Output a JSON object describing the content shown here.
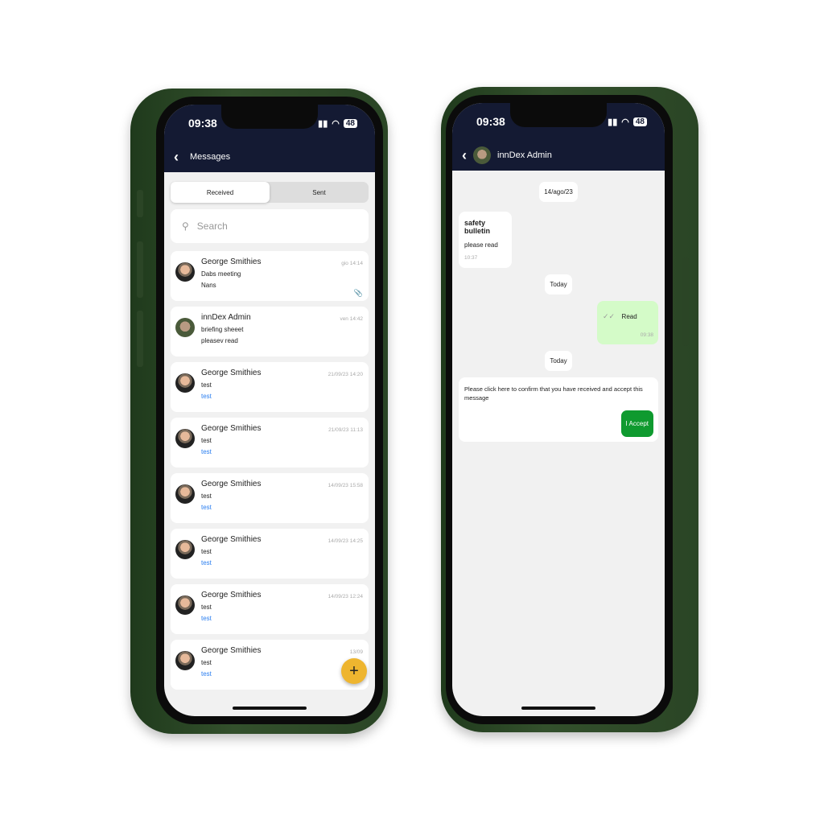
{
  "left_phone": {
    "status": {
      "time": "09:38",
      "battery": "48"
    },
    "header": {
      "title": "Messages"
    },
    "tabs": [
      {
        "label": "Received",
        "active": true
      },
      {
        "label": "Sent",
        "active": false
      }
    ],
    "search": {
      "placeholder": "Search"
    },
    "messages": [
      {
        "sender": "George Smithies",
        "subject": "Dabs meeting",
        "preview": "Nans",
        "time": "gio 14:14",
        "attachment": true
      },
      {
        "sender": "innDex Admin",
        "subject": "briefing sheeet",
        "preview": "pleasev read",
        "time": "ven 14:42"
      },
      {
        "sender": "George Smithies",
        "subject": "test",
        "preview": "test",
        "time": "21/09/23 14:20"
      },
      {
        "sender": "George Smithies",
        "subject": "test",
        "preview": "test",
        "time": "21/09/23 11:13"
      },
      {
        "sender": "George Smithies",
        "subject": "test",
        "preview": "test",
        "time": "14/09/23 15:58"
      },
      {
        "sender": "George Smithies",
        "subject": "test",
        "preview": "test",
        "time": "14/09/23 14:25"
      },
      {
        "sender": "George Smithies",
        "subject": "test",
        "preview": "test",
        "time": "14/09/23 12:24"
      },
      {
        "sender": "George Smithies",
        "subject": "test",
        "preview": "test",
        "time": "13/09"
      }
    ],
    "fab_label": "+",
    "colors": {
      "header": "#141a33",
      "fab": "#eeb52f",
      "link": "#2a7ef0"
    }
  },
  "right_phone": {
    "status": {
      "time": "09:38",
      "battery": "48"
    },
    "header": {
      "title": "innDex Admin"
    },
    "date1": "14/ago/23",
    "msg1": {
      "title": "safety bulletin",
      "body": "please read",
      "time": "10:37"
    },
    "date2": "Today",
    "sent": {
      "body": "Read",
      "time": "09:38"
    },
    "date3": "Today",
    "confirm": {
      "body": "Please click here to confirm that you have received and accept this message",
      "button": "I Accept"
    },
    "colors": {
      "sent_bubble": "#d4fbc8",
      "accept": "#0f9a2f"
    }
  }
}
